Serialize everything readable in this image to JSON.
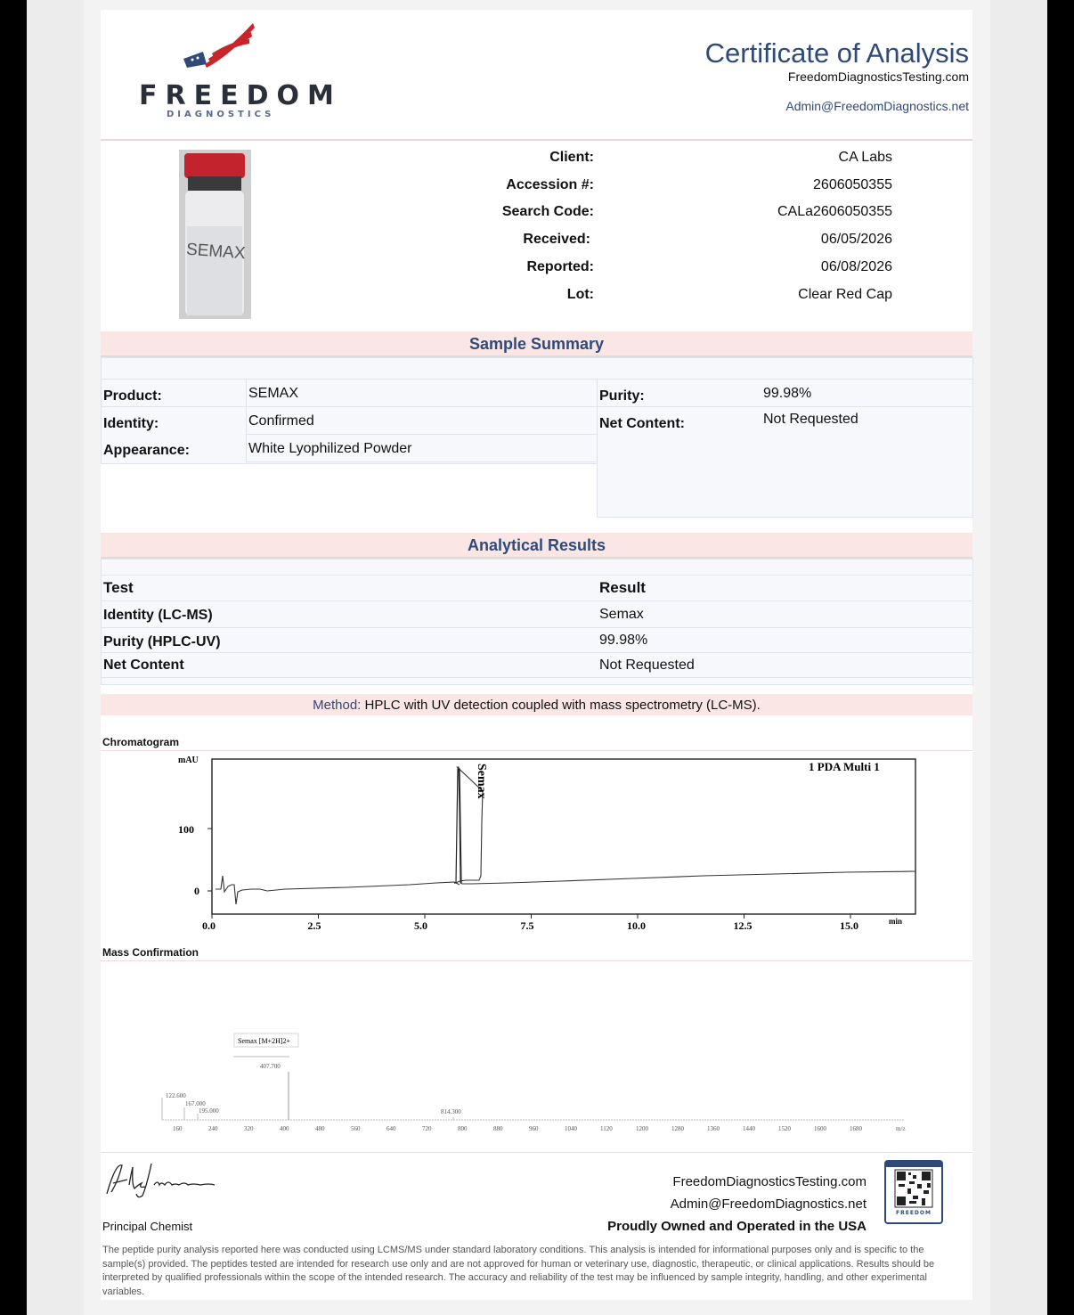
{
  "header": {
    "logo": {
      "word": "FREEDOM",
      "sub": "DIAGNOSTICS"
    },
    "title": "Certificate of Analysis",
    "website": "FreedomDiagnosticsTesting.com",
    "email": "Admin@FreedomDiagnostics.net"
  },
  "vial_label": "SEMAX",
  "client_info": [
    {
      "label": "Client:",
      "value": "CA Labs"
    },
    {
      "label": "Accession #:",
      "value": "2606050355"
    },
    {
      "label": "Search Code:",
      "value": "CALa2606050355"
    },
    {
      "label": "Received:",
      "value": "06/05/2026"
    },
    {
      "label": "Reported:",
      "value": "06/08/2026"
    },
    {
      "label": "Lot:",
      "value": "Clear Red Cap"
    }
  ],
  "sample_summary": {
    "title": "Sample Summary",
    "left": [
      {
        "label": "Product:",
        "value": "SEMAX"
      },
      {
        "label": "Identity:",
        "value": "Confirmed"
      },
      {
        "label": "Appearance:",
        "value": "White Lyophilized Powder"
      }
    ],
    "right": [
      {
        "label": "Purity:",
        "value": "99.98%"
      },
      {
        "label": "Net Content:",
        "value": "Not Requested"
      }
    ]
  },
  "analytical_results": {
    "title": "Analytical Results",
    "headers": [
      "Test",
      "Result"
    ],
    "rows": [
      {
        "test": "Identity (LC-MS)",
        "result": "Semax"
      },
      {
        "test": "Purity (HPLC-UV)",
        "result": "99.98%"
      },
      {
        "test": "Net Content",
        "result": "Not Requested"
      }
    ],
    "method_label": "Method:",
    "method_text": "HPLC with UV detection coupled with mass spectrometry (LC-MS)."
  },
  "chromatogram": {
    "section_label": "Chromatogram",
    "y_unit": "mAU",
    "x_unit": "min",
    "channel": "1 PDA Multi 1",
    "peak_label": "Semax",
    "y_ticks": [
      "100",
      "0"
    ],
    "x_ticks": [
      "0.0",
      "2.5",
      "5.0",
      "7.5",
      "10.0",
      "12.5",
      "15.0"
    ]
  },
  "mass_confirmation": {
    "section_label": "Mass Confirmation",
    "annotation": "Semax [M+2H]2+",
    "x_unit": "m/z",
    "x_ticks": [
      "160",
      "240",
      "320",
      "400",
      "480",
      "560",
      "640",
      "720",
      "800",
      "880",
      "960",
      "1040",
      "1120",
      "1200",
      "1280",
      "1360",
      "1440",
      "1520",
      "1600",
      "1680"
    ],
    "peak_labels": [
      "407.700",
      "122.600",
      "167.000",
      "195.000",
      "814.300"
    ]
  },
  "footer": {
    "signature": "Alex Johnson",
    "role": "Principal Chemist",
    "website": "FreedomDiagnosticsTesting.com",
    "email": "Admin@FreedomDiagnostics.net",
    "tagline": "Proudly Owned and Operated in the USA",
    "qr_caption": "FREEDOM",
    "disclaimer": "The peptide purity analysis reported here was conducted using LCMS/MS under standard laboratory conditions. This analysis is intended for informational purposes only and is specific to the sample(s) provided. The peptides tested are intended for research use only and are not approved for human or veterinary use, diagnostic, therapeutic, or clinical applications. Results should be interpreted by qualified professionals within the scope of the intended research. The accuracy and reliability of the test may be influenced by sample integrity, handling, and other experimental variables."
  },
  "colors": {
    "accent": "#2f4a78",
    "band": "#fbe6e6",
    "logo_red": "#c8242b"
  }
}
